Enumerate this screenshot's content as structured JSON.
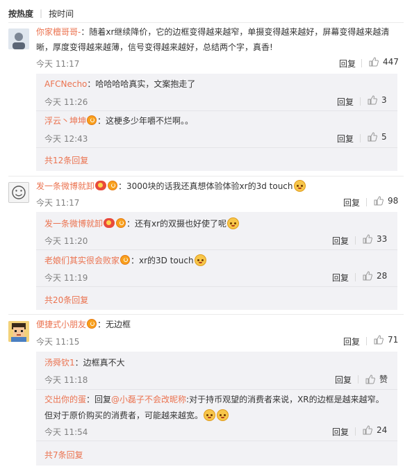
{
  "sort": {
    "hot": "按热度",
    "time": "按时间"
  },
  "reply_label": "回复",
  "comments": [
    {
      "user": "你家檀哥哥-",
      "text": "：随着xr继续降价，它的边框变得越来越窄，单摄变得越来越好，屏幕变得越来越清",
      "text2": "晰，厚度变得越来越薄，信号变得越来越好，总结两个字，真香!",
      "time": "今天 11:17",
      "likes": "447",
      "replies": [
        {
          "user": "AFCNecho",
          "text": "：哈哈哈哈真实，文案抱走了",
          "time": "今天 11:26",
          "likes": "3"
        },
        {
          "user": "浮云丶坤坤",
          "text": "：这梗多少年嚼不烂啊。。",
          "time": "今天 12:43",
          "likes": "5"
        }
      ],
      "more": "共12条回复"
    },
    {
      "user": "发一条微博就卸",
      "text": "：3000块的话我还真想体验体验xr的3d touch",
      "time": "今天 11:17",
      "likes": "98",
      "replies": [
        {
          "user": "发一条微博就卸",
          "text": "：还有xr的双摄也好使了呢",
          "time": "今天 11:20",
          "likes": "33"
        },
        {
          "user": "老娘们其实很会败家",
          "text": "：xr的3D touch",
          "time": "今天 11:19",
          "likes": "28"
        }
      ],
      "more": "共20条回复"
    },
    {
      "user": "便捷式小朋友",
      "text": "：无边框",
      "time": "今天 11:15",
      "likes": "71",
      "replies": [
        {
          "user": "汤舜钦1",
          "text": "：边框真不大",
          "time": "今天 11:18",
          "likes": "赞"
        },
        {
          "user": "交出你的蛋",
          "text_pre": "：回复",
          "mention": "@小磊子不会改昵称",
          "text": ":对于持币观望的消费者来说，XR的边框是越来越窄。",
          "text2": "但对于原价购买的消费者，可能越来越宽。",
          "time": "今天 11:54",
          "likes": "24"
        }
      ],
      "more": "共7条回复"
    }
  ]
}
